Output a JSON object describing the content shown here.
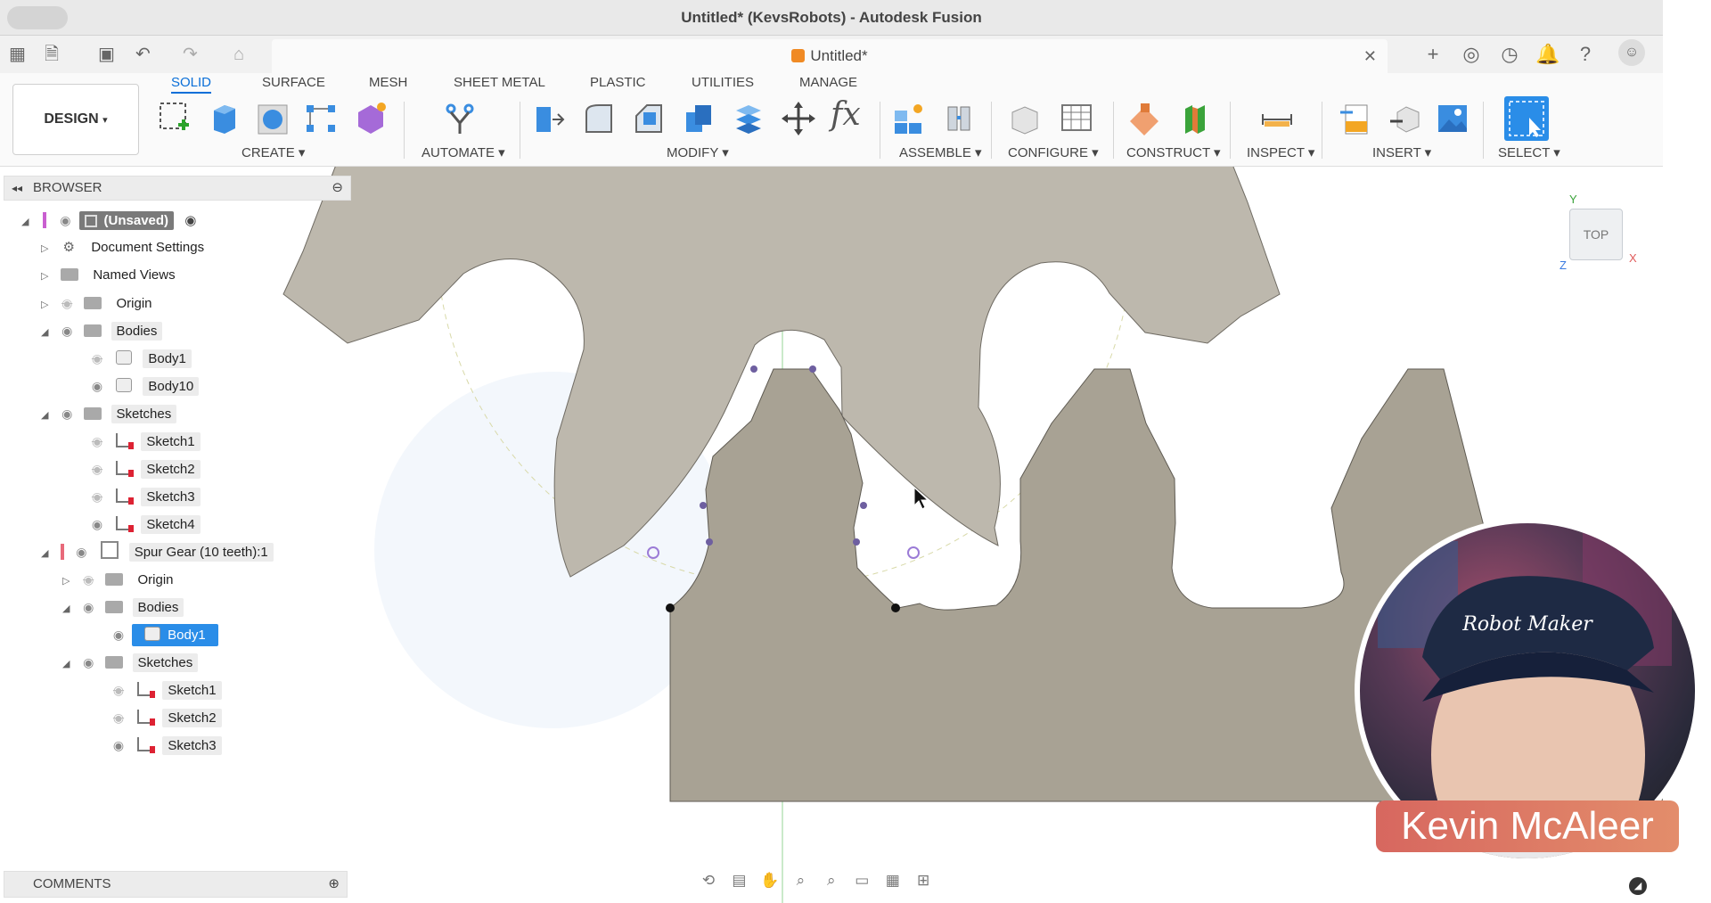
{
  "window": {
    "title": "Untitled* (KevsRobots) - Autodesk Fusion"
  },
  "document_tab": {
    "label": "Untitled*"
  },
  "workspace": {
    "label": "DESIGN",
    "caret": "▾"
  },
  "ribbon": {
    "tabs": [
      "SOLID",
      "SURFACE",
      "MESH",
      "SHEET METAL",
      "PLASTIC",
      "UTILITIES",
      "MANAGE"
    ],
    "active_tab": "SOLID",
    "groups": [
      "CREATE ▾",
      "AUTOMATE ▾",
      "MODIFY ▾",
      "ASSEMBLE ▾",
      "CONFIGURE ▾",
      "CONSTRUCT ▾",
      "INSPECT ▾",
      "INSERT ▾",
      "SELECT ▾"
    ],
    "fx_label": "fx"
  },
  "browser": {
    "title": "BROWSER",
    "rows": [
      {
        "label": "(Unsaved)"
      },
      {
        "label": "Document Settings"
      },
      {
        "label": "Named Views"
      },
      {
        "label": "Origin"
      },
      {
        "label": "Bodies"
      },
      {
        "label": "Body1"
      },
      {
        "label": "Body10"
      },
      {
        "label": "Sketches"
      },
      {
        "label": "Sketch1"
      },
      {
        "label": "Sketch2"
      },
      {
        "label": "Sketch3"
      },
      {
        "label": "Sketch4"
      },
      {
        "label": "Spur Gear (10 teeth):1"
      },
      {
        "label": "Origin"
      },
      {
        "label": "Bodies"
      },
      {
        "label": "Body1"
      },
      {
        "label": "Sketches"
      },
      {
        "label": "Sketch1"
      },
      {
        "label": "Sketch2"
      },
      {
        "label": "Sketch3"
      }
    ]
  },
  "comments": {
    "label": "COMMENTS"
  },
  "viewcube": {
    "face": "TOP",
    "x_label": "X",
    "y_label": "Y",
    "z_label": "Z"
  },
  "overlay": {
    "name": "Kevin McAleer",
    "cap_text": "Robot Maker"
  },
  "colors": {
    "accent": "#0a6fd8",
    "gear_upper": "#bdb8ad",
    "gear_rack": "#a8a294",
    "selection": "#2a8de8"
  }
}
